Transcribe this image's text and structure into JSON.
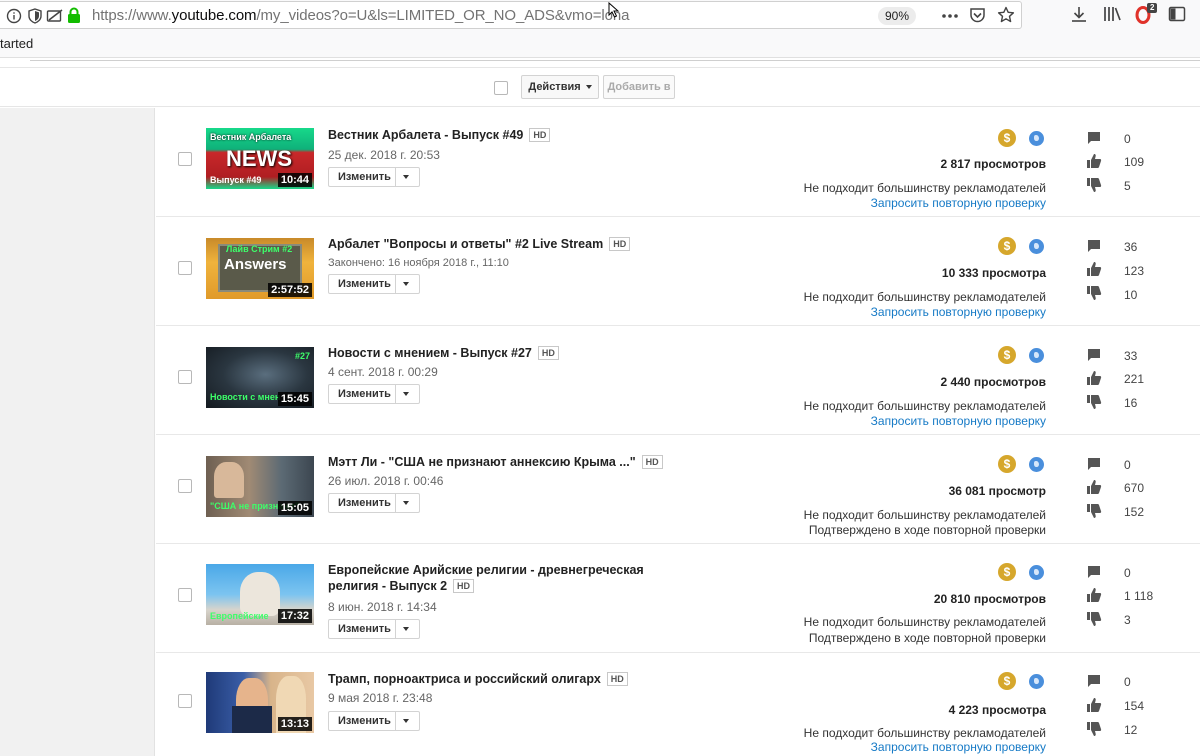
{
  "browser": {
    "url_prefix": "https://www.",
    "url_domain": "youtube.com",
    "url_path": "/my_videos?o=U&ls=LIMITED_OR_NO_ADS&vmo=lona",
    "zoom": "90%",
    "badge_count": "2",
    "bookmark_label": "tarted"
  },
  "toolbar": {
    "actions_label": "Действия",
    "add_to_label": "Добавить в"
  },
  "videos": [
    {
      "title": "Вестник Арбалета - Выпуск #49",
      "hd": "HD",
      "date": "25 дек. 2018 г. 20:53",
      "duration": "10:44",
      "thumb_top": "Вестник Арбалета",
      "thumb_bottom": "Выпуск #49",
      "edit_label": "Изменить",
      "views": "2 817 просмотров",
      "ad_status": "Не подходит большинству рекламодателей",
      "ad_action": "Запросить повторную проверку",
      "comments": "0",
      "likes": "109",
      "dislikes": "5"
    },
    {
      "title": "Арбалет \"Вопросы и ответы\" #2 Live Stream",
      "hd": "HD",
      "date": "Закончено: 16 ноября 2018 г., 11:10",
      "duration": "2:57:52",
      "thumb_top": "Лайв Стрим #2",
      "thumb_bottom": "Answers",
      "edit_label": "Изменить",
      "views": "10 333 просмотра",
      "ad_status": "Не подходит большинству рекламодателей",
      "ad_action": "Запросить повторную проверку",
      "comments": "36",
      "likes": "123",
      "dislikes": "10"
    },
    {
      "title": "Новости с мнением - Выпуск #27",
      "hd": "HD",
      "date": "4 сент. 2018 г. 00:29",
      "duration": "15:45",
      "thumb_top": "#27",
      "thumb_bottom": "Новости с мнен",
      "edit_label": "Изменить",
      "views": "2 440 просмотров",
      "ad_status": "Не подходит большинству рекламодателей",
      "ad_action": "Запросить повторную проверку",
      "comments": "33",
      "likes": "221",
      "dislikes": "16"
    },
    {
      "title": "Мэтт Ли - \"США не признают аннексию Крыма ...\"",
      "hd": "HD",
      "date": "26 июл. 2018 г. 00:46",
      "duration": "15:05",
      "thumb_top": "",
      "thumb_bottom": "\"США не признают\"",
      "edit_label": "Изменить",
      "views": "36 081 просмотр",
      "ad_status": "Не подходит большинству рекламодателей",
      "ad_action": "Подтверждено в ходе повторной проверки",
      "comments": "0",
      "likes": "670",
      "dislikes": "152"
    },
    {
      "title": "Европейские Арийские религии - древнегреческая религия - Выпуск 2",
      "hd": "HD",
      "date": "8 июн. 2018 г. 14:34",
      "duration": "17:32",
      "thumb_top": "",
      "thumb_bottom": "Европейские",
      "edit_label": "Изменить",
      "views": "20 810 просмотров",
      "ad_status": "Не подходит большинству рекламодателей",
      "ad_action": "Подтверждено в ходе повторной проверки",
      "comments": "0",
      "likes": "1 118",
      "dislikes": "3"
    },
    {
      "title": "Трамп, порноактриса и российский олигарх",
      "hd": "HD",
      "date": "9 мая 2018 г. 23:48",
      "duration": "13:13",
      "thumb_top": "",
      "thumb_bottom": "",
      "edit_label": "Изменить",
      "views": "4 223 просмотра",
      "ad_status": "Не подходит большинству рекламодателей",
      "ad_action": "Запросить повторную проверку",
      "comments": "0",
      "likes": "154",
      "dislikes": "12"
    }
  ],
  "colors": {
    "link": "#167ac6",
    "monetization": "#d6a72c",
    "public": "#4a8fdc"
  }
}
